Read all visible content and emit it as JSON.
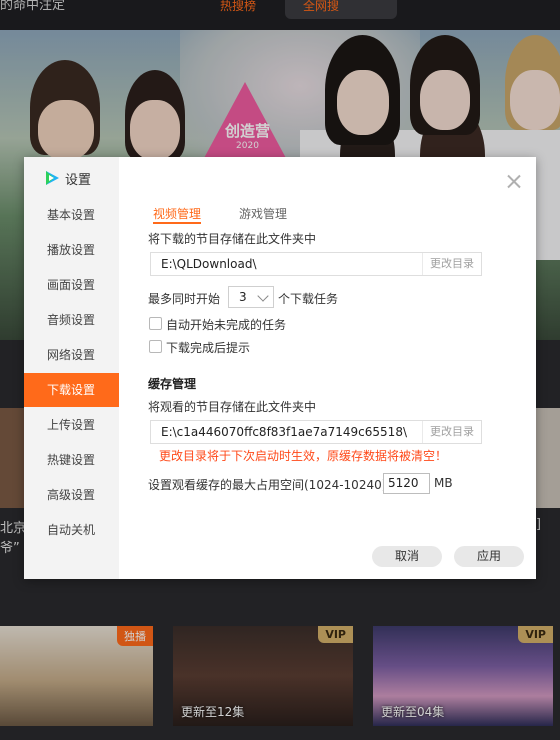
{
  "background": {
    "top_left_text": "的命中注定",
    "hot_tab": "热搜榜",
    "all_tab": "全网搜",
    "banner_logo": "创造营",
    "banner_year": "2020",
    "side_caption_1": "北京",
    "side_caption_2": "爷”",
    "side_right_caption": "]",
    "thumbs": [
      {
        "badge": "独播",
        "caption": ""
      },
      {
        "badge": "VIP",
        "caption": "更新至12集"
      },
      {
        "badge": "VIP",
        "caption": "更新至04集"
      }
    ]
  },
  "dialog": {
    "title": "设置",
    "sidebar": [
      "基本设置",
      "播放设置",
      "画面设置",
      "音频设置",
      "网络设置",
      "下载设置",
      "上传设置",
      "热键设置",
      "高级设置",
      "自动关机"
    ],
    "active_index": 5,
    "tabs": [
      "视频管理",
      "游戏管理"
    ],
    "download_label": "将下载的节目存储在此文件夹中",
    "download_path": "E:\\QLDownload\\",
    "change_dir": "更改目录",
    "max_start_label": "最多同时开始",
    "max_start_value": "3",
    "max_start_suffix": "个下载任务",
    "auto_start": "自动开始未完成的任务",
    "notify_done": "下载完成后提示",
    "cache_title": "缓存管理",
    "cache_label": "将观看的节目存储在此文件夹中",
    "cache_path": "E:\\c1a446070ffc8f83f1ae7a7149c65518\\",
    "warning": "更改目录将于下次启动时生效，原缓存数据将被清空！",
    "cache_space_label": "设置观看缓存的最大占用空间(1024-10240)",
    "cache_space_value": "5120",
    "cache_unit": "MB",
    "cancel": "取消",
    "apply": "应用"
  }
}
